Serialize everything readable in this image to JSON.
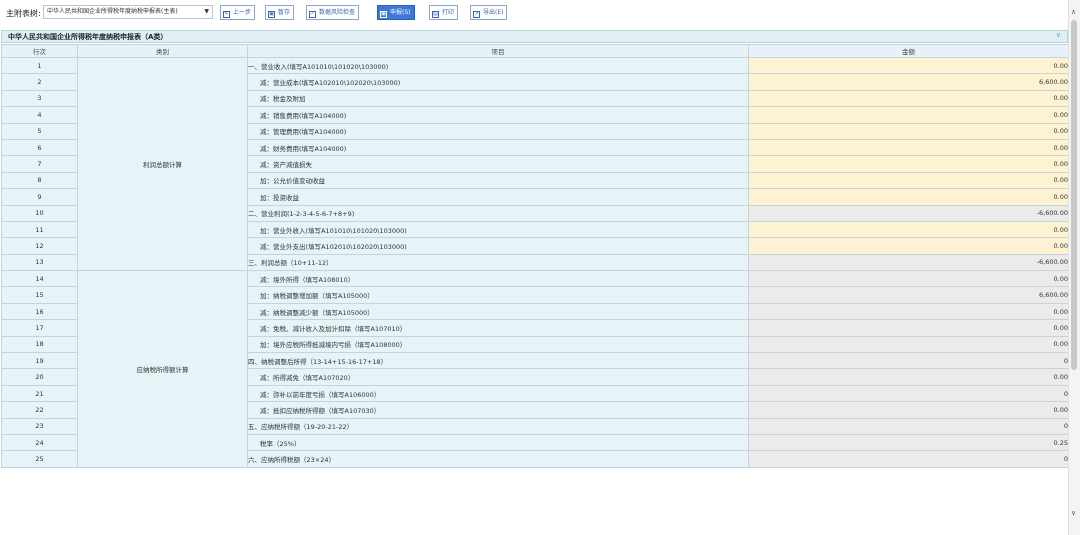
{
  "toolbar": {
    "label": "主附表树:",
    "selected_form": "中华人民共和国企业所得税年度纳税申报表(主表)",
    "buttons": [
      {
        "label": "上一步",
        "icon": "edit-icon"
      },
      {
        "label": "暂存",
        "icon": "save-icon"
      },
      {
        "label": "数据风险检查",
        "icon": "check-icon"
      },
      {
        "label": "申报(S)",
        "icon": "submit-icon"
      },
      {
        "label": "打印",
        "icon": "print-icon"
      },
      {
        "label": "导出(E)",
        "icon": "export-icon"
      }
    ]
  },
  "form": {
    "title": "中华人民共和国企业所得税年度纳税申报表（A类）",
    "columns": {
      "row_no": "行次",
      "category": "类别",
      "item": "项目",
      "amount": "金额"
    },
    "categories": [
      {
        "label": "利润总额计算",
        "start": 1,
        "span": 13
      },
      {
        "label": "应纳税所得额计算",
        "start": 14,
        "span": 12
      }
    ],
    "rows": [
      {
        "no": "1",
        "item": "一、营业收入(填写A101010\\101020\\103000)",
        "amount": "0.00",
        "style": "yel",
        "indent": false
      },
      {
        "no": "2",
        "item": "减：营业成本(填写A102010\\102020\\103000)",
        "amount": "6,600.00",
        "style": "yel",
        "indent": true
      },
      {
        "no": "3",
        "item": "减：税金及附加",
        "amount": "0.00",
        "style": "yel",
        "indent": true
      },
      {
        "no": "4",
        "item": "减：销售费用(填写A104000)",
        "amount": "0.00",
        "style": "yel",
        "indent": true
      },
      {
        "no": "5",
        "item": "减：管理费用(填写A104000)",
        "amount": "0.00",
        "style": "yel",
        "indent": true
      },
      {
        "no": "6",
        "item": "减：财务费用(填写A104000)",
        "amount": "0.00",
        "style": "yel",
        "indent": true
      },
      {
        "no": "7",
        "item": "减：资产减值损失",
        "amount": "0.00",
        "style": "yel",
        "indent": true
      },
      {
        "no": "8",
        "item": "加：公允价值变动收益",
        "amount": "0.00",
        "style": "yel",
        "indent": true
      },
      {
        "no": "9",
        "item": "加：投资收益",
        "amount": "0.00",
        "style": "yel",
        "indent": true
      },
      {
        "no": "10",
        "item": "二、营业利润(1-2-3-4-5-6-7+8+9)",
        "amount": "-6,600.00",
        "style": "gry",
        "indent": false
      },
      {
        "no": "11",
        "item": "加：营业外收入(填写A101010\\101020\\103000)",
        "amount": "0.00",
        "style": "yel",
        "indent": true
      },
      {
        "no": "12",
        "item": "减：营业外支出(填写A102010\\102020\\103000)",
        "amount": "0.00",
        "style": "yel",
        "indent": true
      },
      {
        "no": "13",
        "item": "三、利润总额（10+11-12）",
        "amount": "-6,600.00",
        "style": "gry",
        "indent": false
      },
      {
        "no": "14",
        "item": "减：境外所得（填写A108010）",
        "amount": "0.00",
        "style": "gry",
        "indent": true
      },
      {
        "no": "15",
        "item": "加：纳税调整增加额（填写A105000）",
        "amount": "6,600.00",
        "style": "gry",
        "indent": true
      },
      {
        "no": "16",
        "item": "减：纳税调整减少额（填写A105000）",
        "amount": "0.00",
        "style": "gry",
        "indent": true
      },
      {
        "no": "17",
        "item": "减：免税、减计收入及加计扣除（填写A107010）",
        "amount": "0.00",
        "style": "gry",
        "indent": true
      },
      {
        "no": "18",
        "item": "加：境外应税所得抵减境内亏损（填写A108000）",
        "amount": "0.00",
        "style": "gry",
        "indent": true
      },
      {
        "no": "19",
        "item": "四、纳税调整后所得（13-14+15-16-17+18）",
        "amount": "0",
        "style": "gry",
        "indent": false
      },
      {
        "no": "20",
        "item": "减：所得减免（填写A107020）",
        "amount": "0.00",
        "style": "gry",
        "indent": true
      },
      {
        "no": "21",
        "item": "减：弥补以前年度亏损（填写A106000）",
        "amount": "0",
        "style": "gry",
        "indent": true
      },
      {
        "no": "22",
        "item": "减：抵扣应纳税所得额（填写A107030）",
        "amount": "0.00",
        "style": "gry",
        "indent": true
      },
      {
        "no": "23",
        "item": "五、应纳税所得额（19-20-21-22）",
        "amount": "0",
        "style": "gry",
        "indent": false
      },
      {
        "no": "24",
        "item": "税率（25%）",
        "amount": "0.25",
        "style": "gry",
        "indent": true
      },
      {
        "no": "25",
        "item": "六、应纳所得税额（23×24）",
        "amount": "0",
        "style": "gry",
        "indent": false
      }
    ]
  },
  "colors": {
    "label_bg": "#e6f3f7",
    "editable_bg": "#fdf3d2",
    "computed_bg": "#ebebeb",
    "accent": "#3b78d8"
  }
}
